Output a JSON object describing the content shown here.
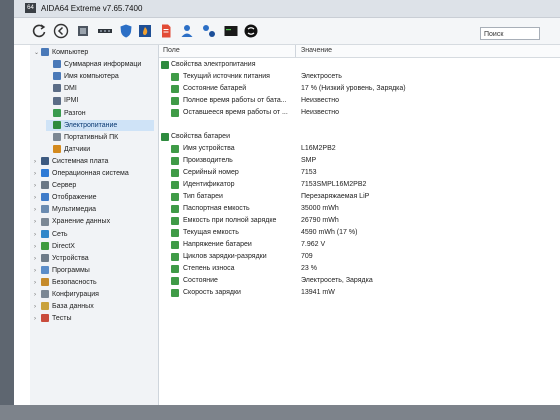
{
  "app": {
    "title": "AIDA64 Extreme v7.65.7400",
    "icon_text": "64"
  },
  "search": {
    "placeholder": "Поиск"
  },
  "toolbar": {
    "icons": [
      "refresh-icon",
      "back-icon",
      "chip-icon",
      "memory-icon",
      "shield-icon",
      "flame-icon",
      "report-icon",
      "user-icon",
      "benchmark-icon",
      "terminal-icon",
      "sync-icon"
    ]
  },
  "sidebar": {
    "items": [
      {
        "label": "Компьютер",
        "level": 0,
        "expanded": true,
        "icon": "computer-icon",
        "color": "#4a79b8"
      },
      {
        "label": "Суммарная информаци",
        "level": 1,
        "icon": "summary-icon",
        "color": "#4a79b8"
      },
      {
        "label": "Имя компьютера",
        "level": 1,
        "icon": "computer-name-icon",
        "color": "#4a79b8"
      },
      {
        "label": "DMI",
        "level": 1,
        "icon": "dmi-icon",
        "color": "#5b6c86"
      },
      {
        "label": "IPMI",
        "level": 1,
        "icon": "ipmi-icon",
        "color": "#5b6c86"
      },
      {
        "label": "Разгон",
        "level": 1,
        "icon": "overclock-icon",
        "color": "#3a9a4e"
      },
      {
        "label": "Электропитание",
        "level": 1,
        "icon": "power-icon",
        "color": "#2e8b3e",
        "selected": true
      },
      {
        "label": "Портативный ПК",
        "level": 1,
        "icon": "laptop-icon",
        "color": "#7c8793"
      },
      {
        "label": "Датчики",
        "level": 1,
        "icon": "sensor-icon",
        "color": "#d48a1e"
      },
      {
        "label": "Системная плата",
        "level": 0,
        "icon": "motherboard-icon",
        "color": "#3d5a80"
      },
      {
        "label": "Операционная система",
        "level": 0,
        "icon": "os-icon",
        "color": "#2d7ad6"
      },
      {
        "label": "Сервер",
        "level": 0,
        "icon": "server-icon",
        "color": "#6b7785"
      },
      {
        "label": "Отображение",
        "level": 0,
        "icon": "display-icon",
        "color": "#3e7bc9"
      },
      {
        "label": "Мультимедиа",
        "level": 0,
        "icon": "multimedia-icon",
        "color": "#6a8bb0"
      },
      {
        "label": "Хранение данных",
        "level": 0,
        "icon": "storage-icon",
        "color": "#7b8794"
      },
      {
        "label": "Сеть",
        "level": 0,
        "icon": "network-icon",
        "color": "#2f86c9"
      },
      {
        "label": "DirectX",
        "level": 0,
        "icon": "directx-icon",
        "color": "#3f9b3f"
      },
      {
        "label": "Устройства",
        "level": 0,
        "icon": "devices-icon",
        "color": "#6f7c89"
      },
      {
        "label": "Программы",
        "level": 0,
        "icon": "programs-icon",
        "color": "#5b8dc9"
      },
      {
        "label": "Безопасность",
        "level": 0,
        "icon": "security-icon",
        "color": "#c58a2b"
      },
      {
        "label": "Конфигурация",
        "level": 0,
        "icon": "config-icon",
        "color": "#7b8794"
      },
      {
        "label": "База данных",
        "level": 0,
        "icon": "database-icon",
        "color": "#c9a23c"
      },
      {
        "label": "Тесты",
        "level": 0,
        "icon": "tests-icon",
        "color": "#c94b3c"
      }
    ]
  },
  "table": {
    "col_field": "Поле",
    "col_value": "Значение",
    "rows": [
      {
        "group": true,
        "name": "Свойства электропитания",
        "value": "",
        "icon": "power-group-icon"
      },
      {
        "name": "Текущий источник питания",
        "value": "Электросеть",
        "icon": "power-source-icon"
      },
      {
        "name": "Состояние батарей",
        "value": "17 % (Низкий уровень, Зарядка)",
        "icon": "battery-state-icon"
      },
      {
        "name": "Полное время работы от бата...",
        "value": "Неизвестно",
        "icon": "battery-time-icon"
      },
      {
        "name": "Оставшееся время работы от ...",
        "value": "Неизвестно",
        "icon": "battery-remaining-icon"
      },
      {
        "spacer": true
      },
      {
        "group": true,
        "name": "Свойства батареи",
        "value": "",
        "icon": "battery-group-icon"
      },
      {
        "name": "Имя устройства",
        "value": "L16M2PB2",
        "icon": "device-name-icon"
      },
      {
        "name": "Производитель",
        "value": "SMP",
        "icon": "manufacturer-icon"
      },
      {
        "name": "Серийный номер",
        "value": "7153",
        "icon": "serial-icon"
      },
      {
        "name": "Идентификатор",
        "value": "7153SMPL16M2PB2",
        "icon": "id-icon"
      },
      {
        "name": "Тип батареи",
        "value": "Перезаряжаемая LiP",
        "icon": "battery-type-icon"
      },
      {
        "name": "Паспортная емкость",
        "value": "35000 mWh",
        "icon": "design-capacity-icon"
      },
      {
        "name": "Емкость при полной зарядке",
        "value": "26790 mWh",
        "icon": "full-capacity-icon"
      },
      {
        "name": "Текущая емкость",
        "value": "4590 mWh  (17 %)",
        "icon": "current-capacity-icon"
      },
      {
        "name": "Напряжение батареи",
        "value": "7.962 V",
        "icon": "voltage-icon"
      },
      {
        "name": "Циклов зарядки-разрядки",
        "value": "709",
        "icon": "cycles-icon"
      },
      {
        "name": "Степень износа",
        "value": "23 %",
        "icon": "wear-icon"
      },
      {
        "name": "Состояние",
        "value": "Электросеть, Зарядка",
        "icon": "state-icon"
      },
      {
        "name": "Скорость зарядки",
        "value": "13941 mW",
        "icon": "charge-rate-icon"
      }
    ]
  }
}
